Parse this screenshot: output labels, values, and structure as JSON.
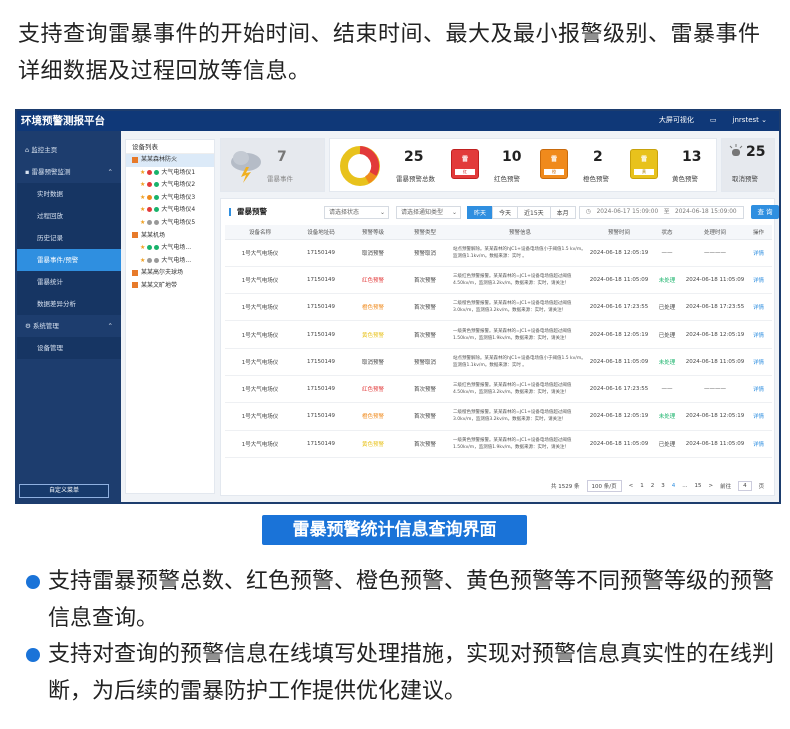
{
  "intro_text": "支持查询雷暴事件的开始时间、结束时间、最大及最小报警级别、雷暴事件详细数据及过程回放等信息。",
  "topbar": {
    "title": "环境预警测报平台",
    "link": "大屏可视化",
    "user": "jnrstest"
  },
  "sidebar": {
    "items": [
      {
        "label": "监控主页"
      },
      {
        "label": "雷暴预警监测"
      },
      {
        "label": "实时数据"
      },
      {
        "label": "过程回放"
      },
      {
        "label": "历史记录"
      },
      {
        "label": "雷暴事件/预警"
      },
      {
        "label": "雷暴统计"
      },
      {
        "label": "数据差异分析"
      },
      {
        "label": "系统管理"
      },
      {
        "label": "设备管理"
      }
    ],
    "custom_menu": "自定义菜单"
  },
  "tree": {
    "title": "设备列表",
    "nodes": [
      {
        "label": "某某森林防火",
        "type": "group"
      },
      {
        "label": "大气电场仪1",
        "type": "leaf"
      },
      {
        "label": "大气电场仪2",
        "type": "leaf"
      },
      {
        "label": "大气电场仪3",
        "type": "leaf"
      },
      {
        "label": "大气电场仪4",
        "type": "leaf"
      },
      {
        "label": "大气电场仪5",
        "type": "leaf"
      },
      {
        "label": "某某机场",
        "type": "group"
      },
      {
        "label": "大气电场...",
        "type": "leaf"
      },
      {
        "label": "大气电场...",
        "type": "leaf"
      },
      {
        "label": "某某高尔夫球场",
        "type": "group"
      },
      {
        "label": "某某文旷地带",
        "type": "group"
      }
    ]
  },
  "stats": {
    "event": {
      "value": "7",
      "label": "雷暴事件"
    },
    "total": {
      "value": "25",
      "label": "雷暴预警总数"
    },
    "red": {
      "value": "10",
      "label": "红色预警"
    },
    "orange": {
      "value": "2",
      "label": "橙色预警"
    },
    "yellow": {
      "value": "13",
      "label": "黄色预警"
    },
    "cancel": {
      "value": "25",
      "label": "取消预警"
    }
  },
  "panel": {
    "title": "雷暴预警",
    "status_placeholder": "请选择状态",
    "type_placeholder": "请选择通知类型",
    "ranges": [
      "昨天",
      "今天",
      "近15天",
      "本月"
    ],
    "date_from": "2024-06-17 15:09:00",
    "date_sep": "至",
    "date_to": "2024-06-18 15:09:00",
    "query_label": "查 询"
  },
  "table": {
    "headers": [
      "设备名称",
      "设备地址码",
      "预警等级",
      "预警类型",
      "预警信息",
      "预警时间",
      "状态",
      "处理时间",
      "操作"
    ],
    "rows": [
      {
        "name": "1号大气电场仪",
        "addr": "17150149",
        "level": "取消预警",
        "lv": "",
        "type": "预警取消",
        "info": "站点预警解除。某某森林的hJC1+设备电场值小于阈值1.5 kv/m。监测值1.1kv/m。数据来源：实时 。",
        "time": "2024-06-18 12:05:19",
        "status": "——",
        "st": "",
        "handled": "————",
        "op": "详情"
      },
      {
        "name": "1号大气电场仪",
        "addr": "17150149",
        "level": "红色预警",
        "lv": "lv-red",
        "type": "首次预警",
        "info": "三级红色预警报警。某某森林的=JC1+设备电场值超过阈值4.50kv/m，监测值3.2kv/m。数据来源：实时，请关注！",
        "time": "2024-06-18 11:05:09",
        "status": "未处理",
        "st": "st-green",
        "handled": "2024-06-18 11:05:09",
        "op": "详情"
      },
      {
        "name": "1号大气电场仪",
        "addr": "17150149",
        "level": "橙色预警",
        "lv": "lv-orange",
        "type": "首次预警",
        "info": "二级橙色预警报警。某某森林的=JC1+设备电场值超过阈值3.0kv/m，监测值3.2kv/m。数据来源：实时，请关注！",
        "time": "2024-06-16 17:23:55",
        "status": "已处理",
        "st": "",
        "handled": "2024-06-18 17:23:55",
        "op": "详情"
      },
      {
        "name": "1号大气电场仪",
        "addr": "17150149",
        "level": "黄色预警",
        "lv": "lv-yellow",
        "type": "首次预警",
        "info": "一级黄色预警报警。某某森林的=JC1+设备电场值超过阈值1.50kv/m，监测值1.9kv/m。数据来源：实时，请关注！",
        "time": "2024-06-18 12:05:19",
        "status": "已处理",
        "st": "",
        "handled": "2024-06-18 12:05:19",
        "op": "详情"
      },
      {
        "name": "1号大气电场仪",
        "addr": "17150149",
        "level": "取消预警",
        "lv": "",
        "type": "预警取消",
        "info": "站点预警解除。某某森林的hJC1+设备电场值小于阈值1.5 kv/m。监测值1.1kv/m。数据来源：实时 。",
        "time": "2024-06-18 11:05:09",
        "status": "未处理",
        "st": "st-green",
        "handled": "2024-06-18 11:05:09",
        "op": "详情"
      },
      {
        "name": "1号大气电场仪",
        "addr": "17150149",
        "level": "红色预警",
        "lv": "lv-red",
        "type": "首次预警",
        "info": "三级红色预警报警。某某森林的=JC1+设备电场值超过阈值4.50kv/m，监测值3.2kv/m。数据来源：实时，请关注！",
        "time": "2024-06-16 17:23:55",
        "status": "——",
        "st": "",
        "handled": "————",
        "op": "详情"
      },
      {
        "name": "1号大气电场仪",
        "addr": "17150149",
        "level": "橙色预警",
        "lv": "lv-orange",
        "type": "首次预警",
        "info": "二级橙色预警报警。某某森林的=JC1+设备电场值超过阈值3.0kv/m，监测值3.2kv/m。数据来源：实时，请关注！",
        "time": "2024-06-18 12:05:19",
        "status": "未处理",
        "st": "st-green",
        "handled": "2024-06-18 12:05:19",
        "op": "详情"
      },
      {
        "name": "1号大气电场仪",
        "addr": "17150149",
        "level": "黄色预警",
        "lv": "lv-yellow",
        "type": "首次预警",
        "info": "一级黄色预警报警。某某森林的=JC1+设备电场值超过阈值1.50kv/m，监测值1.9kv/m。数据来源：实时，请关注！",
        "time": "2024-06-18 11:05:09",
        "status": "已处理",
        "st": "",
        "handled": "2024-06-18 11:05:09",
        "op": "详情"
      }
    ]
  },
  "pager": {
    "total": "共 1529 条",
    "size": "100 条/页",
    "prev": "<",
    "pages": [
      "1",
      "2",
      "3",
      "4",
      "...",
      "15"
    ],
    "next": ">",
    "goto": "前往",
    "goto_value": "4",
    "page_unit": "页"
  },
  "caption": "雷暴预警统计信息查询界面",
  "bullets": [
    "支持雷暴预警总数、红色预警、橙色预警、黄色预警等不同预警等级的预警信息查询。",
    "支持对查询的预警信息在线填写处理措施，实现对预警信息真实性的在线判断，为后续的雷暴防护工作提供优化建议。"
  ],
  "colors": {
    "accent": "#1a73d8",
    "nav": "#1d3d6e",
    "red": "#e23a3a",
    "orange": "#f08a1c",
    "yellow": "#e8c21c"
  }
}
